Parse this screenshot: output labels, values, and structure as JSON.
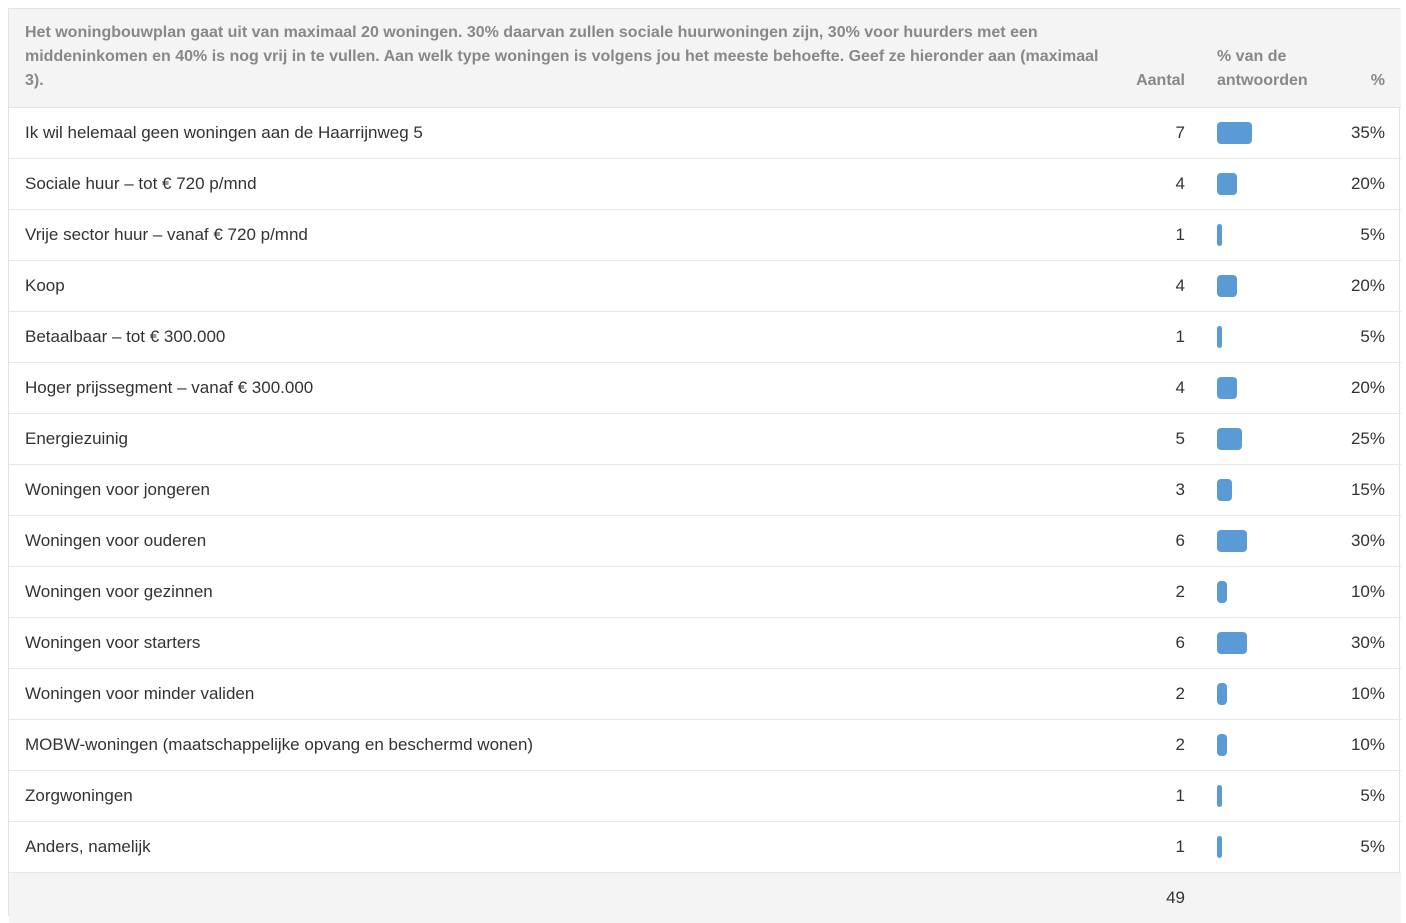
{
  "header": {
    "question": "Het woningbouwplan gaat uit van maximaal 20 woningen. 30% daarvan zullen sociale huurwoningen zijn, 30% voor huurders met een middeninkomen en 40% is nog vrij in te vullen. Aan welk type woningen is volgens jou het meeste behoefte. Geef ze hieronder aan (maximaal 3).",
    "count_label": "Aantal",
    "bar_label": "% van de antwoorden",
    "pct_label": "%"
  },
  "accent_color": "#5b9bd5",
  "rows": [
    {
      "label": "Ik wil helemaal geen woningen aan de Haarrijnweg 5",
      "count": "7",
      "percent": "35%",
      "fraction": 0.35
    },
    {
      "label": "Sociale huur – tot € 720 p/mnd",
      "count": "4",
      "percent": "20%",
      "fraction": 0.2
    },
    {
      "label": "Vrije sector huur – vanaf € 720 p/mnd",
      "count": "1",
      "percent": "5%",
      "fraction": 0.05
    },
    {
      "label": "Koop",
      "count": "4",
      "percent": "20%",
      "fraction": 0.2
    },
    {
      "label": "Betaalbaar – tot € 300.000",
      "count": "1",
      "percent": "5%",
      "fraction": 0.05
    },
    {
      "label": "Hoger prijssegment – vanaf € 300.000",
      "count": "4",
      "percent": "20%",
      "fraction": 0.2
    },
    {
      "label": "Energiezuinig",
      "count": "5",
      "percent": "25%",
      "fraction": 0.25
    },
    {
      "label": "Woningen voor jongeren",
      "count": "3",
      "percent": "15%",
      "fraction": 0.15
    },
    {
      "label": "Woningen voor ouderen",
      "count": "6",
      "percent": "30%",
      "fraction": 0.3
    },
    {
      "label": "Woningen voor gezinnen",
      "count": "2",
      "percent": "10%",
      "fraction": 0.1
    },
    {
      "label": "Woningen voor starters",
      "count": "6",
      "percent": "30%",
      "fraction": 0.3
    },
    {
      "label": "Woningen voor minder validen",
      "count": "2",
      "percent": "10%",
      "fraction": 0.1
    },
    {
      "label": "MOBW-woningen (maatschappelijke opvang en beschermd wonen)",
      "count": "2",
      "percent": "10%",
      "fraction": 0.1
    },
    {
      "label": "Zorgwoningen",
      "count": "1",
      "percent": "5%",
      "fraction": 0.05
    },
    {
      "label": "Anders, namelijk",
      "count": "1",
      "percent": "5%",
      "fraction": 0.05
    }
  ],
  "footer": {
    "total": "49"
  }
}
